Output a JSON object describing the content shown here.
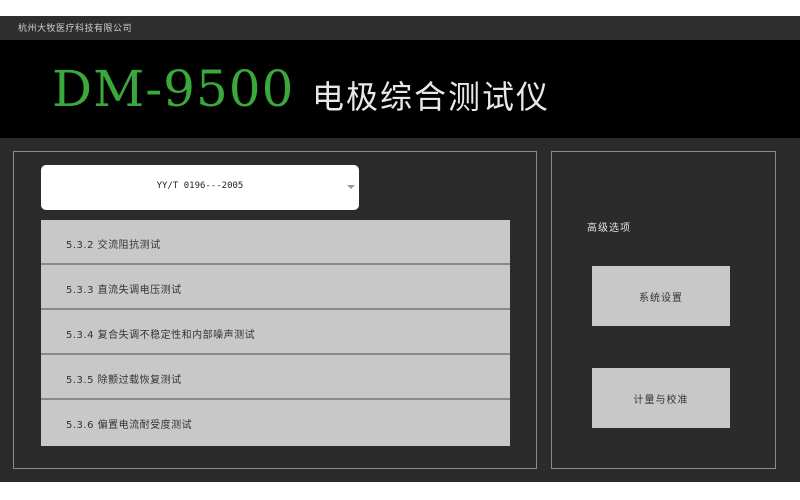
{
  "header": {
    "company": "杭州大牧医疗科技有限公司",
    "model": "DM-9500",
    "device_name": "电极综合测试仪"
  },
  "standard": {
    "selected": "YY/T 0196---2005"
  },
  "tests": [
    {
      "label": "5.3.2 交流阻抗测试"
    },
    {
      "label": "5.3.3 直流失调电压测试"
    },
    {
      "label": "5.3.4 复合失调不稳定性和内部噪声测试"
    },
    {
      "label": "5.3.5 除颤过载恢复测试"
    },
    {
      "label": "5.3.6 偏置电流耐受度测试"
    }
  ],
  "advanced": {
    "title": "高级选项",
    "system_settings": "系统设置",
    "calibration": "计量与校准"
  }
}
